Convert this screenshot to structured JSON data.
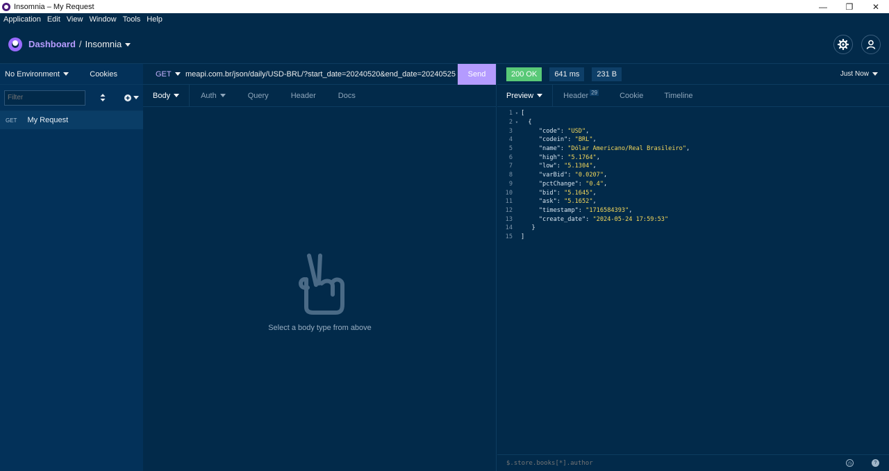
{
  "window": {
    "title": "Insomnia – My Request",
    "controls": {
      "minimize": "—",
      "maximize": "❐",
      "close": "✕"
    }
  },
  "menu": [
    "Application",
    "Edit",
    "View",
    "Window",
    "Tools",
    "Help"
  ],
  "header": {
    "dashboard": "Dashboard",
    "separator": "/",
    "workspace": "Insomnia"
  },
  "sidebar": {
    "environment": "No Environment",
    "cookies": "Cookies",
    "filter_placeholder": "Filter",
    "requests": [
      {
        "method": "GET",
        "name": "My Request"
      }
    ]
  },
  "request": {
    "method": "GET",
    "url": "meapi.com.br/json/daily/USD-BRL/?start_date=20240520&end_date=20240525",
    "send_label": "Send",
    "tabs": [
      "Body",
      "Auth",
      "Query",
      "Header",
      "Docs"
    ],
    "empty_message": "Select a body type from above"
  },
  "response": {
    "status": "200 OK",
    "time": "641 ms",
    "size": "231 B",
    "when": "Just Now",
    "tabs": {
      "preview": "Preview",
      "header": "Header",
      "header_count": "29",
      "cookie": "Cookie",
      "timeline": "Timeline"
    },
    "body": {
      "l1": "[",
      "l2": "{",
      "code_k": "\"code\"",
      "code_v": "\"USD\"",
      "codein_k": "\"codein\"",
      "codein_v": "\"BRL\"",
      "name_k": "\"name\"",
      "name_v": "\"Dólar Americano/Real Brasileiro\"",
      "high_k": "\"high\"",
      "high_v": "\"5.1764\"",
      "low_k": "\"low\"",
      "low_v": "\"5.1304\"",
      "varBid_k": "\"varBid\"",
      "varBid_v": "\"0.0207\"",
      "pctChange_k": "\"pctChange\"",
      "pctChange_v": "\"0.4\"",
      "bid_k": "\"bid\"",
      "bid_v": "\"5.1645\"",
      "ask_k": "\"ask\"",
      "ask_v": "\"5.1652\"",
      "timestamp_k": "\"timestamp\"",
      "timestamp_v": "\"1716584393\"",
      "create_date_k": "\"create_date\"",
      "create_date_v": "\"2024-05-24 17:59:53\"",
      "l14": "}",
      "l15": "]"
    },
    "filter_placeholder": "$.store.books[*].author"
  },
  "colors": {
    "background": "#022a4a",
    "accent": "#b49bff",
    "ok": "#59c977",
    "json_value": "#f5d85b"
  }
}
